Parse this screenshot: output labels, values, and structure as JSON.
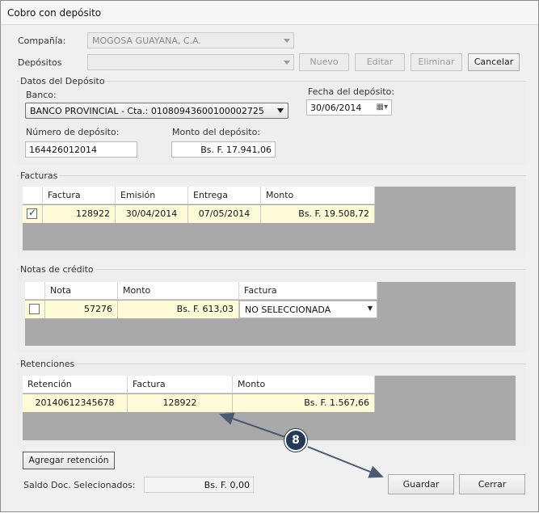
{
  "window": {
    "title": "Cobro con depósito"
  },
  "form": {
    "compania_label": "Compañía:",
    "compania_value": "MOGOSA GUAYANA, C.A.",
    "depositos_label": "Depósitos",
    "depositos_value": "",
    "buttons": {
      "nuevo": "Nuevo",
      "editar": "Editar",
      "eliminar": "Eliminar",
      "cancelar": "Cancelar"
    }
  },
  "deposito": {
    "group_title": "Datos del Depósito",
    "banco_label": "Banco:",
    "banco_value": "BANCO PROVINCIAL - Cta.: 01080943600100002725",
    "fecha_label": "Fecha del depósito:",
    "fecha_value": "30/06/2014",
    "numero_label": "Número de depósito:",
    "numero_value": "164426012014",
    "monto_label": "Monto del depósito:",
    "monto_value": "Bs. F. 17.941,06"
  },
  "facturas": {
    "group_title": "Facturas",
    "columns": [
      "Factura",
      "Emisión",
      "Entrega",
      "Monto"
    ],
    "rows": [
      {
        "checked": true,
        "factura": "128922",
        "emision": "30/04/2014",
        "entrega": "07/05/2014",
        "monto": "Bs. F. 19.508,72"
      }
    ]
  },
  "notas": {
    "group_title": "Notas de crédito",
    "columns": [
      "Nota",
      "Monto",
      "Factura"
    ],
    "rows": [
      {
        "checked": false,
        "nota": "57276",
        "monto": "Bs. F. 613,03",
        "factura": "NO SELECCIONADA"
      }
    ]
  },
  "retenciones": {
    "group_title": "Retenciones",
    "columns": [
      "Retención",
      "Factura",
      "Monto"
    ],
    "rows": [
      {
        "retencion": "20140612345678",
        "factura": "128922",
        "monto": "Bs. F. 1.567,66"
      }
    ]
  },
  "footer": {
    "agregar_retencion": "Agregar retención",
    "saldo_label": "Saldo Doc. Selecionados:",
    "saldo_value": "Bs. F. 0,00",
    "guardar": "Guardar",
    "cerrar": "Cerrar"
  },
  "annotation": {
    "callout_number": "8",
    "color": "#253a57"
  }
}
